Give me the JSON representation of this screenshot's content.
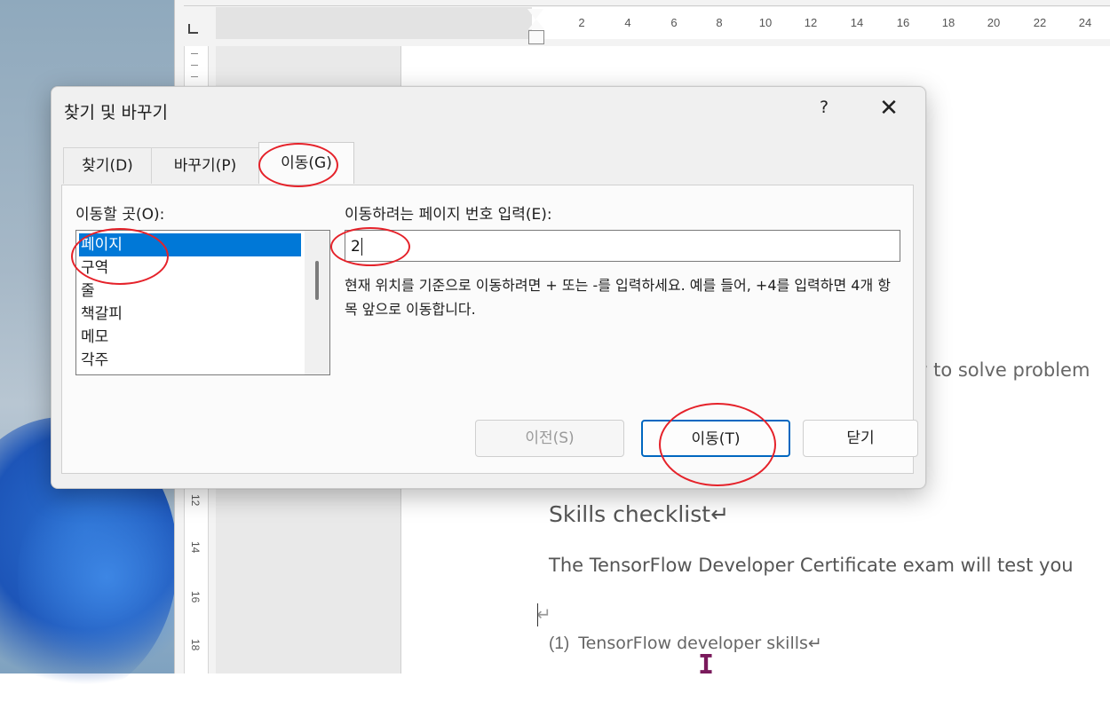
{
  "ruler": {
    "ticks": [
      "2",
      "4",
      "6",
      "8",
      "10",
      "12",
      "14",
      "16",
      "18",
      "20",
      "22",
      "24"
    ],
    "vertical_ticks": [
      "12",
      "14",
      "16",
      "18"
    ]
  },
  "document": {
    "snippet": "y to solve problem",
    "heading": "Skills checklist↵",
    "paragraph": "The TensorFlow Developer Certificate exam will test you",
    "empty_mark": "↵",
    "list_number": "(1)",
    "list_text": "TensorFlow developer skills↵"
  },
  "dialog": {
    "title": "찾기 및 바꾸기",
    "help": "?",
    "close": "✕",
    "tabs": [
      {
        "label": "찾기(D)"
      },
      {
        "label": "바꾸기(P)"
      },
      {
        "label": "이동(G)"
      }
    ],
    "goto_label": "이동할 곳(O):",
    "goto_items": [
      "페이지",
      "구역",
      "줄",
      "책갈피",
      "메모",
      "각주"
    ],
    "input_label": "이동하려는 페이지 번호 입력(E):",
    "input_value": "2",
    "hint": "현재 위치를 기준으로 이동하려면 + 또는 -를 입력하세요. 예를 들어, +4를 입력하면 4개 항목 앞으로 이동합니다.",
    "buttons": {
      "previous": "이전(S)",
      "goto": "이동(T)",
      "close": "닫기"
    }
  },
  "colors": {
    "selection": "#0078d7",
    "annotation": "#e5222a",
    "default_button_border": "#0067c0"
  }
}
